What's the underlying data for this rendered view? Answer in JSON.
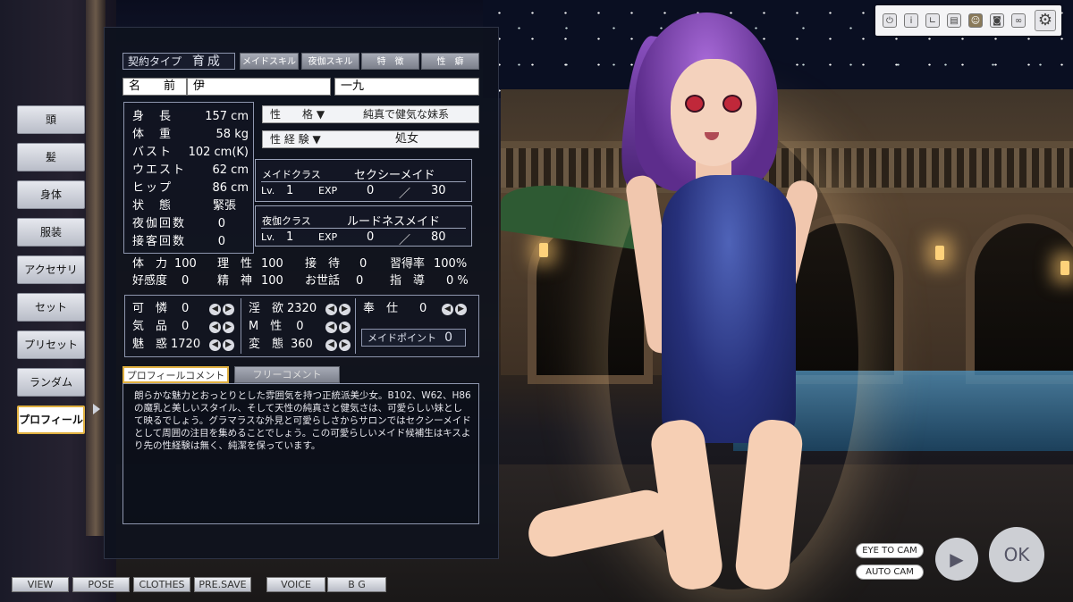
{
  "top_row": {
    "contract_label": "契約タイプ",
    "contract_value": "育成",
    "tabs": [
      "メイドスキル",
      "夜伽スキル",
      "特　徴",
      "性　癖"
    ]
  },
  "name": {
    "label": "名　　前",
    "first": "伊",
    "last": "一九"
  },
  "stats": [
    {
      "key": "身　長",
      "value": "157 cm"
    },
    {
      "key": "体　重",
      "value": "58  kg"
    },
    {
      "key": "バスト",
      "value": "102 cm(K)"
    },
    {
      "key": "ウエスト",
      "value": "62 cm"
    },
    {
      "key": "ヒップ",
      "value": "86 cm"
    },
    {
      "key": "状　態",
      "value": "緊張"
    },
    {
      "key": "夜伽回数",
      "value": "0"
    },
    {
      "key": "接客回数",
      "value": "0"
    }
  ],
  "personality": {
    "label": "性　　格 ▼",
    "value": "純真で健気な妹系"
  },
  "experience": {
    "label": "性 経 験 ▼",
    "value": "処女"
  },
  "maid_class": {
    "label": "メイドクラス",
    "name": "セクシーメイド",
    "lv_label": "Lv.",
    "lv": "1",
    "exp_label": "EXP",
    "exp": "0",
    "sep": "／",
    "max": "30"
  },
  "night_class": {
    "label": "夜伽クラス",
    "name": "ルードネスメイド",
    "lv_label": "Lv.",
    "lv": "1",
    "exp_label": "EXP",
    "exp": "0",
    "sep": "／",
    "max": "80"
  },
  "params_row1": [
    {
      "k": "体　力",
      "v": "100"
    },
    {
      "k": "理　性",
      "v": "100"
    },
    {
      "k": "接　待",
      "v": "0"
    },
    {
      "k": "習得率",
      "v": "100%"
    }
  ],
  "params_row2": [
    {
      "k": "好感度",
      "v": "0"
    },
    {
      "k": "精　神",
      "v": "100"
    },
    {
      "k": "お世話",
      "v": "0"
    },
    {
      "k": "指　導",
      "v": "0 %"
    }
  ],
  "traits": [
    {
      "k": "可　憐",
      "v": "0"
    },
    {
      "k": "淫　欲",
      "v": "2320"
    },
    {
      "k": "奉　仕",
      "v": "0"
    },
    {
      "k": "気　品",
      "v": "0"
    },
    {
      "k": "M　性",
      "v": "0"
    },
    {
      "k": "魅　惑",
      "v": "1720"
    },
    {
      "k": "変　態",
      "v": "360"
    }
  ],
  "maid_points": {
    "label": "メイドポイント",
    "value": "0"
  },
  "comment_tabs": [
    "プロフィールコメント",
    "フリーコメント"
  ],
  "comment_text": "朗らかな魅力とおっとりとした雰囲気を持つ正統派美少女。B102、W62、H86の魔乳と美しいスタイル、そして天性の純真さと健気さは、可愛らしい妹として映るでしょう。グラマラスな外見と可愛らしさからサロンではセクシーメイドとして周囲の注目を集めることでしょう。この可愛らしいメイド候補生はキスより先の性経験は無く、純潔を保っています。",
  "sidebar": [
    "頭",
    "髪",
    "身体",
    "服装",
    "アクセサリ",
    "セット",
    "プリセット",
    "ランダム",
    "プロフィール"
  ],
  "bottom_buttons": [
    "VIEW",
    "POSE",
    "CLOTHES",
    "PRE.SAVE",
    "VOICE",
    "B G"
  ],
  "camera": {
    "eye_to_cam": "EYE TO CAM",
    "auto_cam": "AUTO CAM"
  },
  "ok_label": "OK",
  "toolbar_icons": [
    "power-icon",
    "info-icon",
    "chart-icon",
    "basket-icon",
    "portrait-icon",
    "camera-icon",
    "link-icon",
    "gear-icon"
  ],
  "colors": {
    "active_border": "#e0b040",
    "panel_bg": "#0e121e"
  }
}
